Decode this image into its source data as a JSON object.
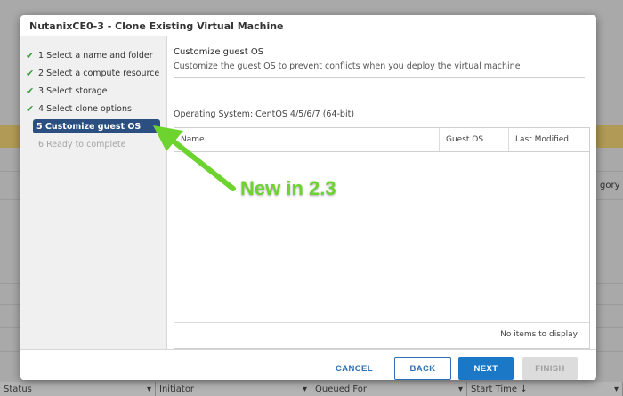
{
  "background": {
    "category_header": "gory",
    "footer_columns": [
      {
        "label": "Status",
        "suffix": ""
      },
      {
        "label": "Initiator",
        "suffix": ""
      },
      {
        "label": "Queued For",
        "suffix": ""
      },
      {
        "label": "Start Time",
        "suffix": "↓"
      }
    ]
  },
  "dialog": {
    "title": "NutanixCE0-3 - Clone Existing Virtual Machine",
    "steps": [
      {
        "label": "1 Select a name and folder",
        "state": "done"
      },
      {
        "label": "2 Select a compute resource",
        "state": "done"
      },
      {
        "label": "3 Select storage",
        "state": "done"
      },
      {
        "label": "4 Select clone options",
        "state": "done"
      },
      {
        "label": "5 Customize guest OS",
        "state": "active"
      },
      {
        "label": "6 Ready to complete",
        "state": "disabled"
      }
    ],
    "content": {
      "title": "Customize guest OS",
      "description": "Customize the guest OS to prevent conflicts when you deploy the virtual machine",
      "operating_system": "Operating System: CentOS 4/5/6/7 (64-bit)",
      "table": {
        "columns": [
          "Name",
          "Guest OS",
          "Last Modified"
        ],
        "rows": [],
        "empty_text": "No items to display"
      }
    },
    "buttons": {
      "cancel": "CANCEL",
      "back": "BACK",
      "next": "NEXT",
      "finish": "FINISH"
    }
  },
  "annotation": {
    "text": "New in 2.3",
    "color": "#6dd42f"
  },
  "colors": {
    "active_step": "#2b4f81",
    "primary_button": "#1b78c6",
    "check": "#3b9a3b"
  }
}
